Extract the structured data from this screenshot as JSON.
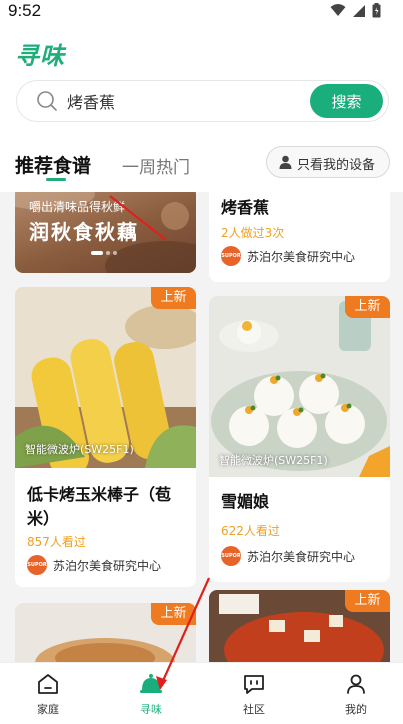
{
  "status_bar": {
    "time": "9:52"
  },
  "header": {
    "logo": "寻味",
    "search": {
      "value": "烤香蕉",
      "button_label": "搜索"
    },
    "tabs": [
      {
        "label": "推荐食谱",
        "active": true
      },
      {
        "label": "一周热门",
        "active": false
      }
    ],
    "device_filter_label": "只看我的设备"
  },
  "banner": {
    "subtitle": "嚼出清味品得秋鲜",
    "title": "润秋食秋藕"
  },
  "cards": [
    {
      "title": "烤香蕉",
      "stat": "2人做过3次",
      "author": "苏泊尔美食研究中心"
    },
    {
      "badge": "上新",
      "device": "智能微波炉(SW25F1)",
      "title": "低卡烤玉米棒子（苞米）",
      "stat": "857人看过",
      "author": "苏泊尔美食研究中心"
    },
    {
      "badge": "上新",
      "device": "智能微波炉(SW25F1)",
      "title": "雪媚娘",
      "stat": "622人看过",
      "author": "苏泊尔美食研究中心"
    },
    {
      "badge": "上新"
    },
    {
      "badge": "上新"
    }
  ],
  "avatar_text": "SUPOR",
  "bottom_nav": [
    {
      "label": "家庭",
      "icon": "home-icon",
      "active": false
    },
    {
      "label": "寻味",
      "icon": "bell-icon",
      "active": true
    },
    {
      "label": "社区",
      "icon": "chat-icon",
      "active": false
    },
    {
      "label": "我的",
      "icon": "person-icon",
      "active": false
    }
  ],
  "colors": {
    "accent": "#19ae7c",
    "badge": "#f07a1f",
    "stat": "#f0a020",
    "annotation_arrow": "#e0201a"
  }
}
